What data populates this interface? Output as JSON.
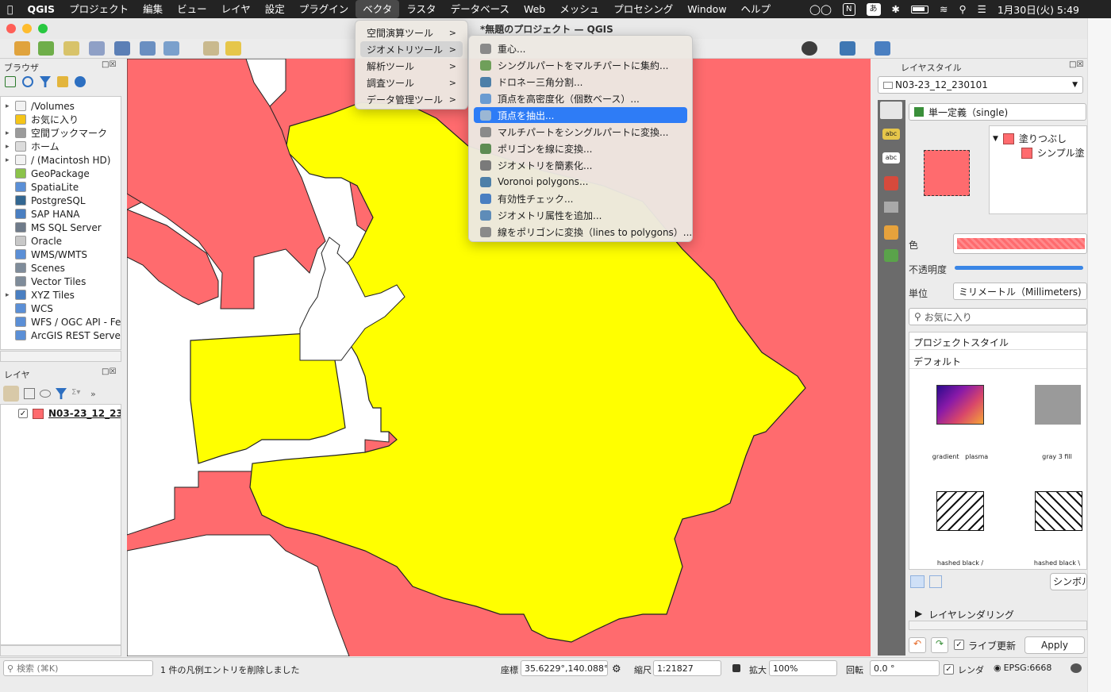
{
  "menubar": {
    "app": "QGIS",
    "items": [
      "プロジェクト",
      "編集",
      "ビュー",
      "レイヤ",
      "設定",
      "プラグイン",
      "ベクタ",
      "ラスタ",
      "データベース",
      "Web",
      "メッシュ",
      "プロセシング",
      "Window",
      "ヘルプ"
    ],
    "active": "ベクタ",
    "ime": "あ",
    "notion": "N",
    "clock": "1月30日(火) 5:49"
  },
  "window": {
    "title": "*無題のプロジェクト — QGIS"
  },
  "browser": {
    "title": "ブラウザ",
    "items": [
      {
        "label": "/Volumes",
        "arrow": "▸",
        "icon": "#f2f2f2"
      },
      {
        "label": "お気に入り",
        "arrow": "",
        "icon": "#f5c518"
      },
      {
        "label": "空間ブックマーク",
        "arrow": "▸",
        "icon": "#9b9b9b"
      },
      {
        "label": "ホーム",
        "arrow": "▸",
        "icon": "#dcdcdc"
      },
      {
        "label": "/ (Macintosh HD)",
        "arrow": "▸",
        "icon": "#f2f2f2"
      },
      {
        "label": "GeoPackage",
        "arrow": "",
        "icon": "#8bc34a"
      },
      {
        "label": "SpatiaLite",
        "arrow": "",
        "icon": "#5b8fd6"
      },
      {
        "label": "PostgreSQL",
        "arrow": "",
        "icon": "#336791"
      },
      {
        "label": "SAP HANA",
        "arrow": "",
        "icon": "#4a7fc1"
      },
      {
        "label": "MS SQL Server",
        "arrow": "",
        "icon": "#6f7b8a"
      },
      {
        "label": "Oracle",
        "arrow": "",
        "icon": "#c8c8c8"
      },
      {
        "label": "WMS/WMTS",
        "arrow": "",
        "icon": "#5b8fd6"
      },
      {
        "label": "Scenes",
        "arrow": "",
        "icon": "#7f8c9a"
      },
      {
        "label": "Vector Tiles",
        "arrow": "",
        "icon": "#7f8c9a"
      },
      {
        "label": "XYZ Tiles",
        "arrow": "▸",
        "icon": "#4a7fc1"
      },
      {
        "label": "WCS",
        "arrow": "",
        "icon": "#5b8fd6"
      },
      {
        "label": "WFS / OGC API - Fe",
        "arrow": "",
        "icon": "#5b8fd6"
      },
      {
        "label": "ArcGIS REST Server",
        "arrow": "",
        "icon": "#5b8fd6"
      }
    ]
  },
  "layers": {
    "title": "レイヤ",
    "layer_name": "N03-23_12_23",
    "layer_color": "#ff6b6e"
  },
  "vector_menu": {
    "items": [
      {
        "label": "空間演算ツール",
        "hl": false
      },
      {
        "label": "ジオメトリツール",
        "hl": true
      },
      {
        "label": "解析ツール",
        "hl": false
      },
      {
        "label": "調査ツール",
        "hl": false
      },
      {
        "label": "データ管理ツール",
        "hl": false
      }
    ],
    "sub_arrow": ">"
  },
  "geometry_menu": {
    "items": [
      {
        "label": "重心...",
        "icon": "#8a8a8a"
      },
      {
        "label": "シングルパートをマルチパートに集約...",
        "icon": "#6f9f5a"
      },
      {
        "label": "ドロネー三角分割...",
        "icon": "#4d7fa8"
      },
      {
        "label": "頂点を高密度化（個数ベース）...",
        "icon": "#6a9bd1"
      },
      {
        "label": "頂点を抽出...",
        "icon": "#9bb7d4"
      },
      {
        "label": "マルチパートをシングルパートに変換...",
        "icon": "#8a8a8a"
      },
      {
        "label": "ポリゴンを線に変換...",
        "icon": "#5e8c53"
      },
      {
        "label": "ジオメトリを簡素化...",
        "icon": "#7a7a7a"
      },
      {
        "label": "Voronoi polygons...",
        "icon": "#4d7fa8"
      },
      {
        "label": "有効性チェック...",
        "icon": "#4a7fc1"
      },
      {
        "label": "ジオメトリ属性を追加...",
        "icon": "#5e8cb8"
      },
      {
        "label": "線をポリゴンに変換（lines to polygons）...",
        "icon": "#8a8a8a"
      }
    ],
    "highlighted": "頂点を抽出..."
  },
  "style_panel": {
    "title": "レイヤスタイル",
    "layer_select": "N03-23_12_230101",
    "renderer": "単一定義（single)",
    "tree_fill": "塗りつぶし",
    "tree_simple": "シンプル塗",
    "color_label": "色",
    "opacity_label": "不透明度",
    "opacity": 1.0,
    "unit_label": "単位",
    "unit_value": "ミリメートル（Millimeters)",
    "search_placeholder": "お気に入り",
    "project_styles": "プロジェクトスタイル",
    "default": "デフォルト",
    "swatches": [
      {
        "label": "gradient   plasma",
        "kind": "gradient"
      },
      {
        "label": "gray 3 fill",
        "kind": "gray"
      },
      {
        "label": "hashed black /",
        "kind": "hash1"
      },
      {
        "label": "hashed black \\",
        "kind": "hash2"
      }
    ],
    "symbol_btn": "シンボル",
    "layer_rendering": "レイヤレンダリング",
    "live_update": "ライブ更新",
    "apply": "Apply"
  },
  "status": {
    "search_placeholder": "検索 (⌘K)",
    "message": "1 件の凡例エントリを削除しました",
    "coord_label": "座標",
    "coord": "35.6229°,140.088°",
    "scale_label": "縮尺",
    "scale": "1:21827",
    "zoom_label": "拡大",
    "zoom": "100%",
    "rotation_label": "回転",
    "rotation": "0.0 °",
    "render_label": "レンダ",
    "crs": "EPSG:6668"
  },
  "colors": {
    "land_red": "#ff6b6e",
    "selected_yellow": "#ffff00",
    "highlight": "#2e7cf6"
  }
}
